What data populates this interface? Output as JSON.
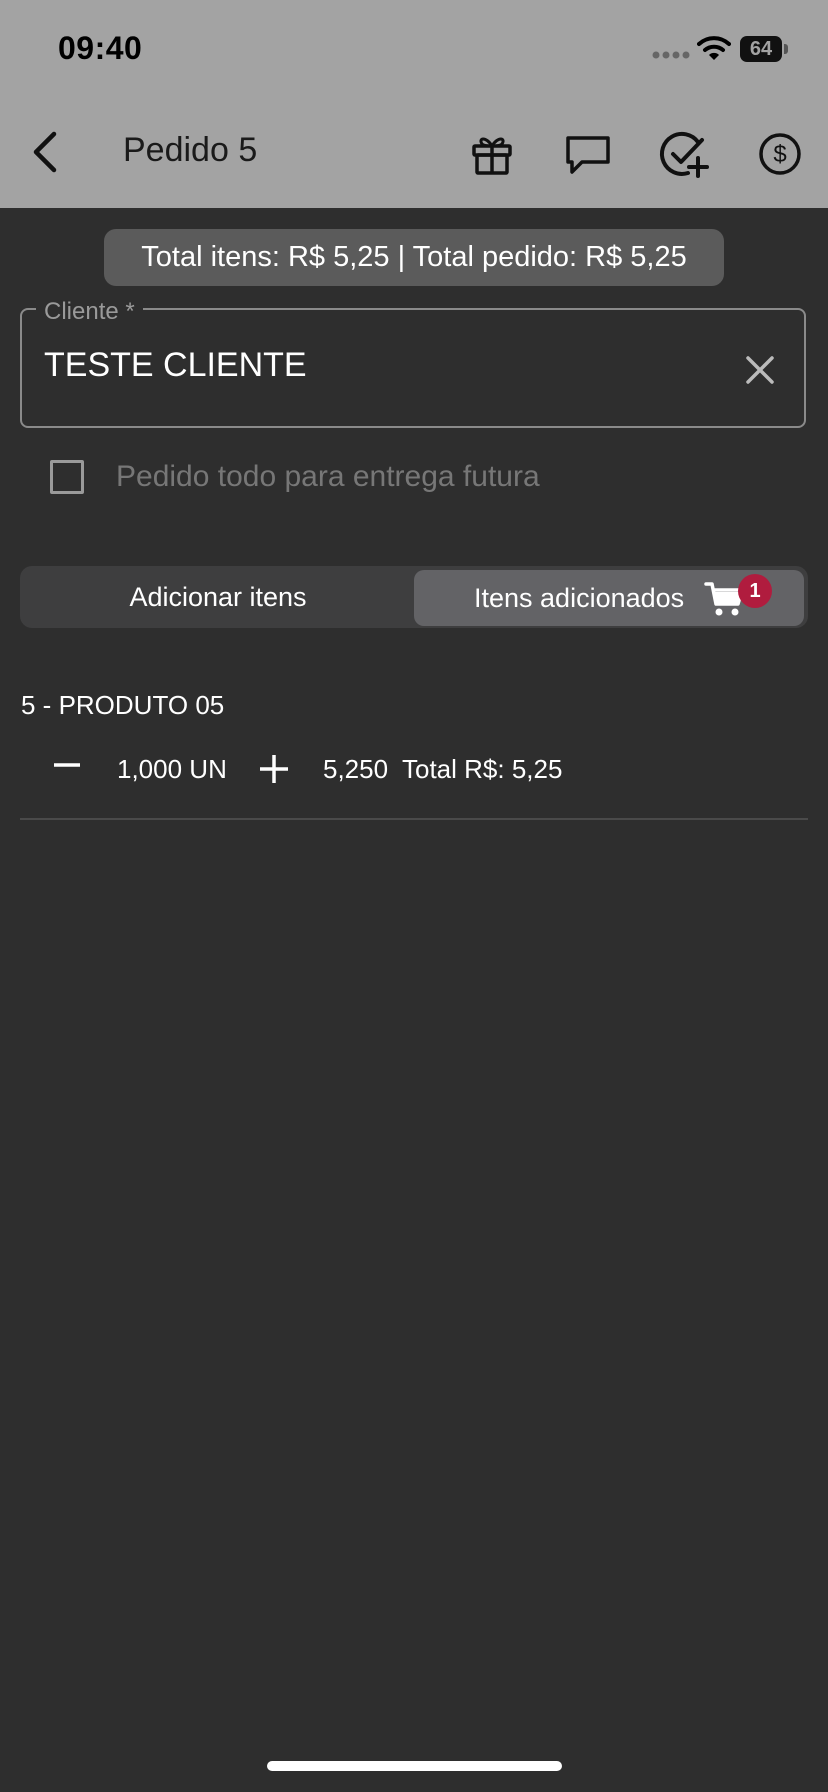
{
  "status_bar": {
    "time": "09:40",
    "battery": "64"
  },
  "header": {
    "title": "Pedido 5",
    "icons": [
      "gift-icon",
      "chat-icon",
      "check-add-icon",
      "dollar-icon"
    ]
  },
  "summary": {
    "text": "Total itens: R$ 5,25 | Total pedido: R$ 5,25"
  },
  "cliente_field": {
    "label": "Cliente *",
    "value": "TESTE CLIENTE"
  },
  "future_delivery": {
    "label": "Pedido todo para entrega futura",
    "checked": false
  },
  "segments": {
    "add_items": "Adicionar itens",
    "added_items": "Itens adicionados",
    "badge_count": "1",
    "selected": "added_items"
  },
  "items": [
    {
      "name": "5 - PRODUTO 05",
      "quantity": "1,000 UN",
      "unit_price": "5,250",
      "total": "Total R$: 5,25"
    }
  ],
  "colors": {
    "header_bg": "#a3a3a3",
    "page_bg": "#2e2e2e",
    "badge": "#b01c3e",
    "segment_selected": "#636366"
  }
}
